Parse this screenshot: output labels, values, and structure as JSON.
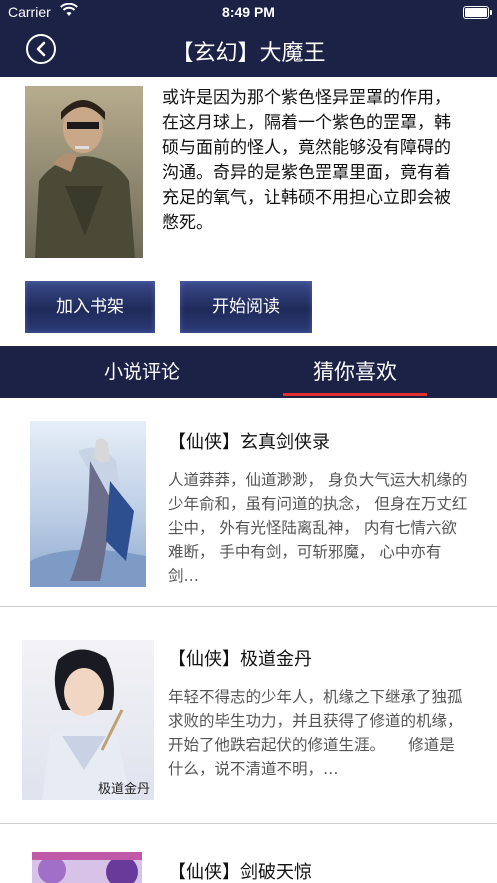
{
  "status_bar": {
    "carrier": "Carrier",
    "time": "8:49 PM"
  },
  "nav": {
    "title": "【玄幻】大魔王"
  },
  "book": {
    "description": "或许是因为那个紫色怪异罡罩的作用，在这月球上，隔着一个紫色的罡罩，韩硕与面前的怪人，竟然能够没有障碍的沟通。奇异的是紫色罡罩里面，竟有着充足的氧气，让韩硕不用担心立即会被憋死。"
  },
  "actions": {
    "add_shelf": "加入书架",
    "start_read": "开始阅读"
  },
  "tabs": [
    {
      "label": "小说评论",
      "active": false
    },
    {
      "label": "猜你喜欢",
      "active": true
    }
  ],
  "recommendations": [
    {
      "title": "【仙侠】玄真剑侠录",
      "intro": "人道莽莽，仙道渺渺， 身负大气运大机缘的少年俞和，虽有问道的执念， 但身在万丈红尘中， 外有光怪陆离乱神， 内有七情六欲难断， 手中有剑，可斩邪魔， 心中亦有剑…"
    },
    {
      "title": "【仙侠】极道金丹",
      "intro": "年轻不得志的少年人，机缘之下继承了独孤求败的毕生功力，并且获得了修道的机缘，开始了他跌宕起伏的修道生涯。　　修道是什么，说不清道不明，…",
      "cover_text": "极道金丹"
    },
    {
      "title": "【仙侠】剑破天惊",
      "intro": ""
    }
  ],
  "colors": {
    "nav_bg": "#1c2246",
    "tab_indicator": "#e03030"
  }
}
